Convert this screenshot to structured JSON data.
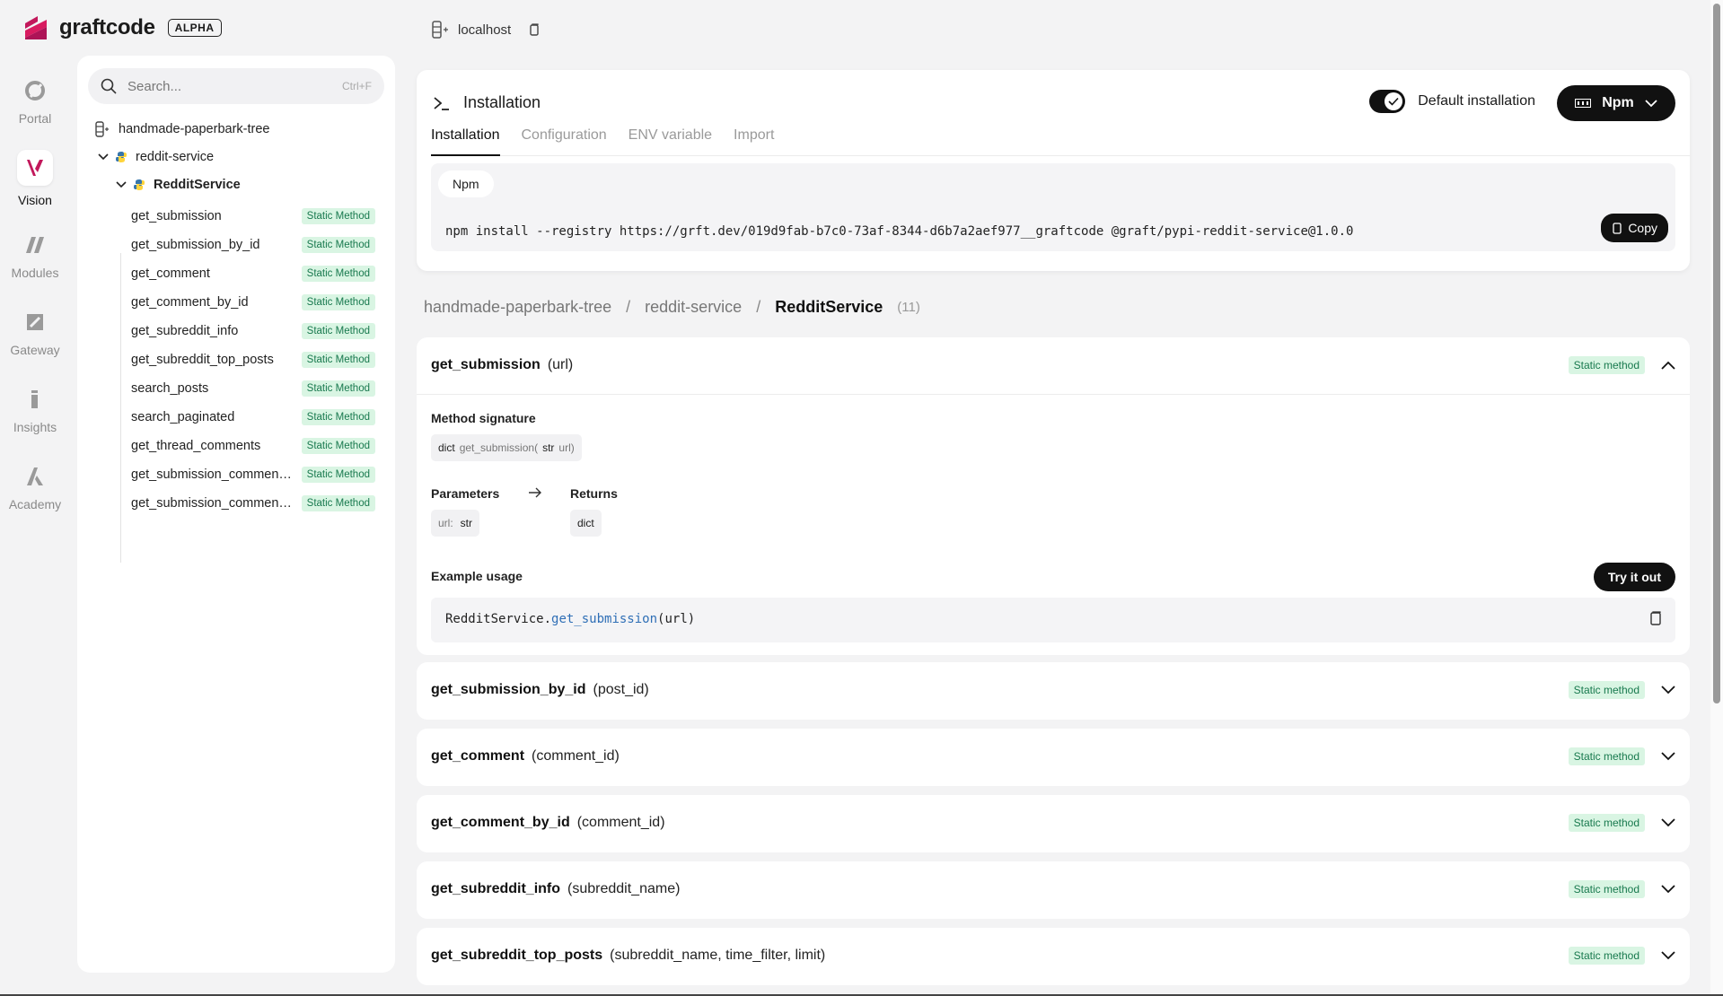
{
  "app": {
    "name": "graftcode",
    "badge": "ALPHA"
  },
  "host": {
    "label": "localhost"
  },
  "rail": [
    {
      "label": "Portal",
      "icon": "portal-icon"
    },
    {
      "label": "Vision",
      "icon": "vision-icon",
      "active": true
    },
    {
      "label": "Modules",
      "icon": "modules-icon"
    },
    {
      "label": "Gateway",
      "icon": "gateway-icon"
    },
    {
      "label": "Insights",
      "icon": "insights-icon"
    },
    {
      "label": "Academy",
      "icon": "academy-icon"
    }
  ],
  "sidebar": {
    "search_placeholder": "Search...",
    "search_shortcut": "Ctrl+F",
    "root": "handmade-paperbark-tree",
    "service": "reddit-service",
    "class": "RedditService",
    "methods": [
      {
        "name": "get_submission",
        "badge": "Static Method"
      },
      {
        "name": "get_submission_by_id",
        "badge": "Static Method"
      },
      {
        "name": "get_comment",
        "badge": "Static Method"
      },
      {
        "name": "get_comment_by_id",
        "badge": "Static Method"
      },
      {
        "name": "get_subreddit_info",
        "badge": "Static Method"
      },
      {
        "name": "get_subreddit_top_posts",
        "badge": "Static Method"
      },
      {
        "name": "search_posts",
        "badge": "Static Method"
      },
      {
        "name": "search_paginated",
        "badge": "Static Method"
      },
      {
        "name": "get_thread_comments",
        "badge": "Static Method"
      },
      {
        "name": "get_submission_comments...",
        "badge": "Static Method"
      },
      {
        "name": "get_submission_comments...",
        "badge": "Static Method"
      }
    ]
  },
  "installation": {
    "title": "Installation",
    "toggle_label": "Default installation",
    "manager_button": "Npm",
    "tabs": [
      "Installation",
      "Configuration",
      "ENV variable",
      "Import"
    ],
    "chip": "Npm",
    "command": "npm install --registry https://grft.dev/019d9fab-b7c0-73af-8344-d6b7a2aef977__graftcode @graft/pypi-reddit-service@1.0.0",
    "copy_label": "Copy"
  },
  "breadcrumb": {
    "items": [
      "handmade-paperbark-tree",
      "reddit-service"
    ],
    "current": "RedditService",
    "count": "(11)",
    "separator": "/"
  },
  "methods": [
    {
      "name": "get_submission",
      "args": "(url)",
      "badge": "Static method",
      "expanded": true,
      "signature_label": "Method signature",
      "sig": {
        "ret": "dict",
        "fn": "get_submission(",
        "ptype": "str",
        "pname": "url)"
      },
      "params_label": "Parameters",
      "returns_label": "Returns",
      "param": {
        "name": "url:",
        "type": "str"
      },
      "returns": "dict",
      "usage_label": "Example usage",
      "try_label": "Try it out",
      "usage": {
        "obj": "RedditService.",
        "method": "get_submission",
        "args": "(url)"
      }
    },
    {
      "name": "get_submission_by_id",
      "args": "(post_id)",
      "badge": "Static method"
    },
    {
      "name": "get_comment",
      "args": "(comment_id)",
      "badge": "Static method"
    },
    {
      "name": "get_comment_by_id",
      "args": "(comment_id)",
      "badge": "Static method"
    },
    {
      "name": "get_subreddit_info",
      "args": "(subreddit_name)",
      "badge": "Static method"
    },
    {
      "name": "get_subreddit_top_posts",
      "args": "(subreddit_name, time_filter, limit)",
      "badge": "Static method"
    }
  ]
}
